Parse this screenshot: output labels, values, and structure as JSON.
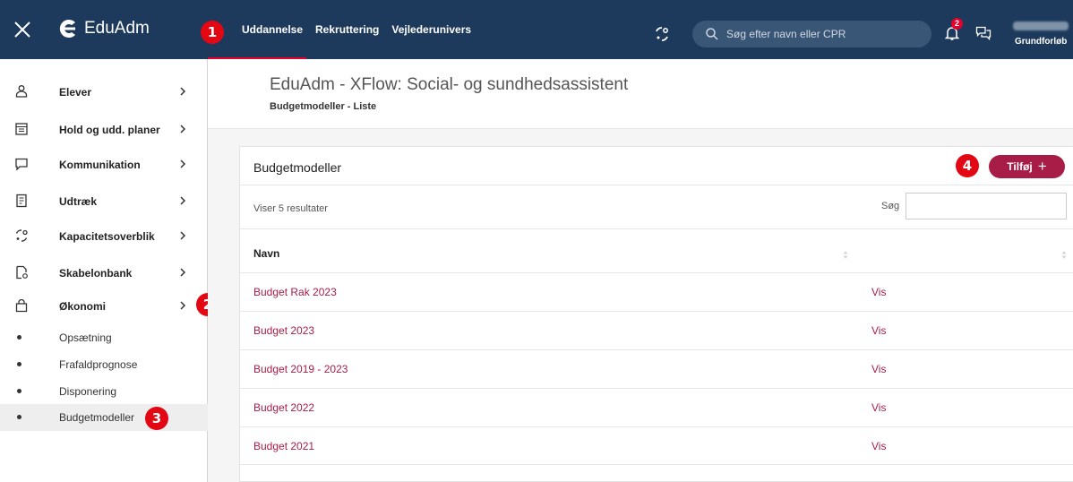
{
  "topbar": {
    "brand": "EduAdm",
    "nav": [
      "Uddannelse",
      "Rekruttering",
      "Vejlederunivers"
    ],
    "search_placeholder": "Søg efter navn eller CPR",
    "notification_count": "2",
    "user_label": "Grundforløb",
    "background": "#1d3a5c"
  },
  "callouts": [
    "1",
    "2",
    "3",
    "4"
  ],
  "sidebar": {
    "items": [
      {
        "label": "Elever",
        "icon": "person-icon"
      },
      {
        "label": "Hold og udd. planer",
        "icon": "calendar-icon"
      },
      {
        "label": "Kommunikation",
        "icon": "message-icon"
      },
      {
        "label": "Udtræk",
        "icon": "document-icon"
      },
      {
        "label": "Kapacitetsoverblik",
        "icon": "capacity-icon"
      },
      {
        "label": "Skabelonbank",
        "icon": "template-icon"
      },
      {
        "label": "Økonomi",
        "icon": "bag-icon"
      }
    ],
    "subitems": [
      "Opsætning",
      "Frafaldprognose",
      "Disponering",
      "Budgetmodeller"
    ],
    "active_subitem": "Budgetmodeller"
  },
  "header": {
    "title": "EduAdm - XFlow: Social- og sundhedsassistent",
    "breadcrumb": "Budgetmodeller - Liste"
  },
  "card": {
    "title": "Budgetmodeller",
    "add_label": "Tilføj",
    "result_count": "Viser 5 resultater",
    "search_label": "Søg",
    "column": "Navn",
    "rows": [
      {
        "name": "Budget Rak 2023",
        "action": "Vis"
      },
      {
        "name": "Budget 2023",
        "action": "Vis"
      },
      {
        "name": "Budget 2019 - 2023",
        "action": "Vis"
      },
      {
        "name": "Budget 2022",
        "action": "Vis"
      },
      {
        "name": "Budget 2021",
        "action": "Vis"
      }
    ]
  },
  "colors": {
    "accent": "#a81d48",
    "callout": "#e30613",
    "active_tab_underline": "#e3002b"
  }
}
